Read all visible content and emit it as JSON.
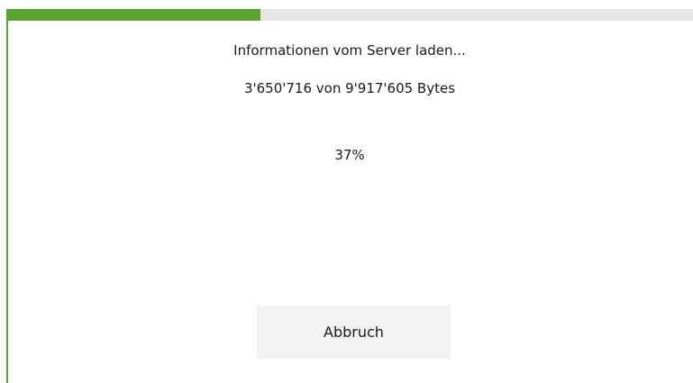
{
  "progress": {
    "fraction": 0.37,
    "fill_color": "#5aa532",
    "track_color": "#e6e6e6"
  },
  "status_text": "Informationen vom Server laden...",
  "bytes_text": "3'650'716 von 9'917'605 Bytes",
  "percent_text": "37%",
  "cancel_label": "Abbruch"
}
